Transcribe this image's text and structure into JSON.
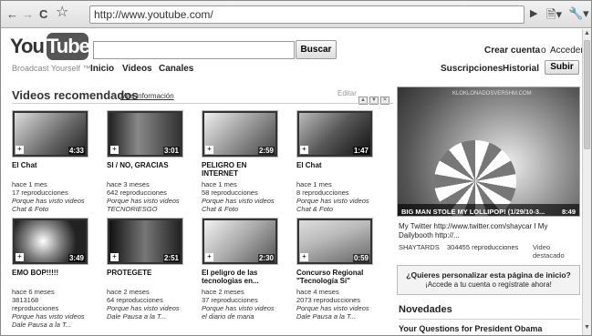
{
  "browser": {
    "url": "http://www.youtube.com/"
  },
  "header": {
    "logo_you": "You",
    "logo_tube": "Tube",
    "tagline": "Broadcast Yourself ™",
    "search_button": "Buscar",
    "search_value": "",
    "nav": [
      "Inicio",
      "Videos",
      "Canales"
    ],
    "create_account": "Crear cuenta",
    "or": "o",
    "sign_in": "Acceder",
    "right_nav": [
      "Suscripciones",
      "Historial"
    ],
    "upload": "Subir"
  },
  "section": {
    "title": "Videos recomendados",
    "more": "Más información",
    "edit": "Editar"
  },
  "videos": [
    {
      "title": "El Chat",
      "title2": "",
      "duration": "4:33",
      "age": "hace 1 mes",
      "views": "17 reproducciones",
      "reason": "Porque has visto videos",
      "source": "Chat & Foto"
    },
    {
      "title": "SI / NO, GRACIAS",
      "title2": "",
      "duration": "3:01",
      "age": "hace 3 meses",
      "views": "642 reproducciones",
      "reason": "Porque has visto videos",
      "source": "TECNORIESGO"
    },
    {
      "title": "PELIGRO EN",
      "title2": "INTERNET",
      "duration": "2:59",
      "age": "hace 1 mes",
      "views": "58 reproducciones",
      "reason": "Porque has visto videos",
      "source": "Chat & Foto"
    },
    {
      "title": "El Chat",
      "title2": "",
      "duration": "1:47",
      "age": "hace 1 mes",
      "views": "8 reproducciones",
      "reason": "Porque has visto videos",
      "source": "Chat & Foto"
    },
    {
      "title": "EMO BOP!!!!!",
      "title2": "",
      "duration": "3:49",
      "age": "hace 6 meses",
      "views": "3813168",
      "views2": "reproducciones",
      "reason": "Porque has visto videos",
      "source": "Dale Pausa a la T..."
    },
    {
      "title": "PROTEGETE",
      "title2": "",
      "duration": "2:51",
      "age": "hace 2 meses",
      "views": "64 reproducciones",
      "reason": "Porque has visto videos",
      "source": "Dale Pausa a la T..."
    },
    {
      "title": "El peligro de las",
      "title2": "tecnologias en...",
      "duration": "2:30",
      "age": "hace 2 meses",
      "views": "37 reproducciones",
      "reason": "Porque has visto videos",
      "source": "el diario de maria"
    },
    {
      "title": "Concurso Regional",
      "title2": "\"Tecnología Sí\"",
      "duration": "0:59",
      "age": "hace 4 meses",
      "views": "2073 reproducciones",
      "reason": "Porque has visto videos",
      "source": "Dale Pausa a la T..."
    }
  ],
  "featured": {
    "site": "KLOKLONADOSVERSHM.COM",
    "title": "BIG MAN STOLE MY LOLLIPOP! (1/29/10-3...",
    "duration": "8:49",
    "description": "My Twitter http://www.twitter.com/shaycar I My Dailybooth http://...",
    "channel": "SHAYTARDS",
    "views": "304455 reproducciones",
    "badge": "Video destacado"
  },
  "promo": {
    "line1": "¿Quieres personalizar esta página de inicio?",
    "line2": "¡Accede a tu cuenta o regístrate ahora!"
  },
  "news": {
    "title": "Novedades",
    "item": "Your Questions for President Obama"
  }
}
